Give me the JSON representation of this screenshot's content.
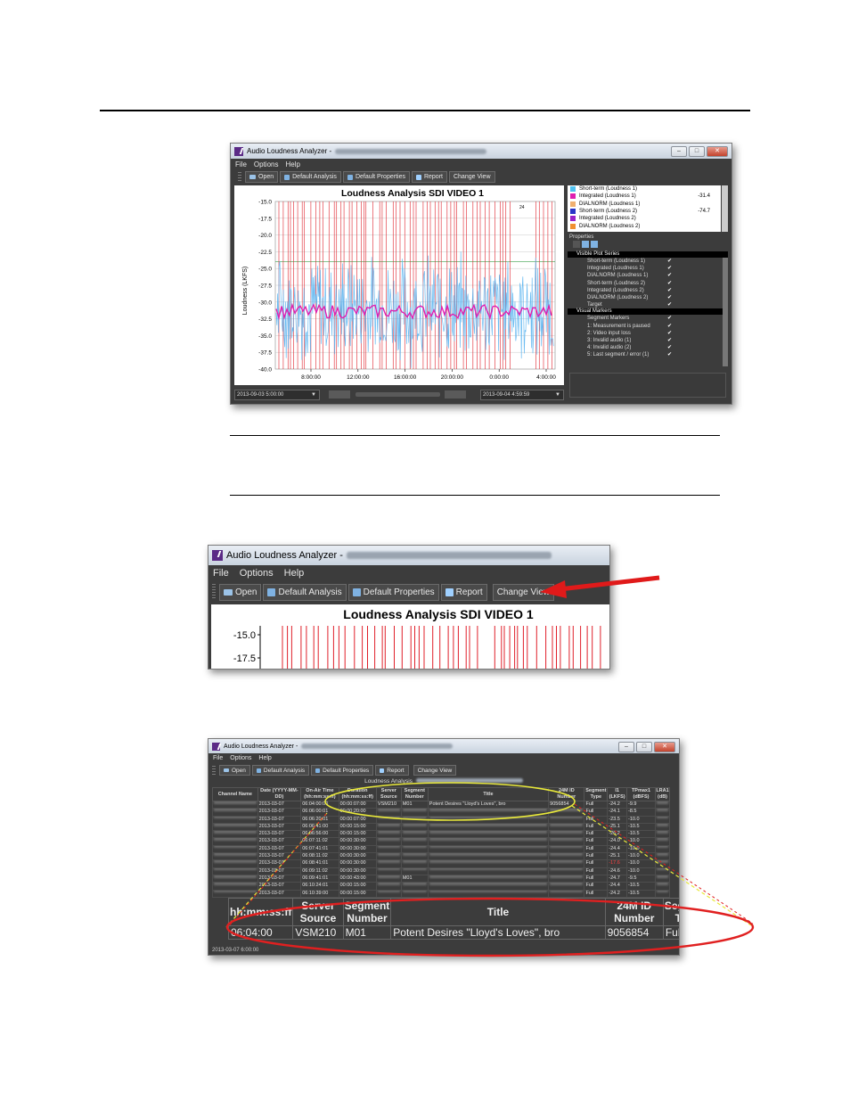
{
  "app": {
    "title": "Audio Loudness Analyzer -",
    "menus": [
      "File",
      "Options",
      "Help"
    ],
    "toolbar": {
      "open": "Open",
      "default_analysis": "Default Analysis",
      "default_properties": "Default Properties",
      "report": "Report",
      "change_view": "Change View"
    },
    "window_buttons": {
      "minimize": "–",
      "maximize": "□",
      "close": "✕"
    }
  },
  "graph_view": {
    "chart_data": {
      "type": "line",
      "title": "Loudness Analysis SDI VIDEO 1",
      "ylabel": "Loudness (LKFS)",
      "y_ticks": [
        "-15.0",
        "-17.5",
        "-20.0",
        "-22.5",
        "-25.0",
        "-27.5",
        "-30.0",
        "-32.5",
        "-35.0",
        "-37.5",
        "-40.0"
      ],
      "ylim": [
        -40.0,
        -15.0
      ],
      "x_ticks": [
        "8:00:00",
        "12:00:00",
        "16:00:00",
        "20:00:00",
        "0:00:00",
        "4:00:00"
      ],
      "series": [
        {
          "name": "Short-term (Loudness 1)",
          "color": "#5ab4f0"
        },
        {
          "name": "Integrated (Loudness 1)",
          "color": "#e01fb0"
        }
      ],
      "segment_markers_color": "#e0202a",
      "segment_marker_label": "24"
    },
    "legend": [
      {
        "name": "Short-term (Loudness 1)",
        "color": "#4fc1f0",
        "value": ""
      },
      {
        "name": "Integrated (Loudness 1)",
        "color": "#e01fb0",
        "value": "-31.4"
      },
      {
        "name": "DIALNORM (Loudness 1)",
        "color": "#f0b070",
        "value": ""
      },
      {
        "name": "Short-term (Loudness 2)",
        "color": "#2a35c8",
        "value": "-74.7"
      },
      {
        "name": "Integrated (Loudness 2)",
        "color": "#9a22c8",
        "value": ""
      },
      {
        "name": "DIALNORM (Loudness 2)",
        "color": "#f09030",
        "value": ""
      }
    ],
    "properties_title": "Properties",
    "visible_plot_series_header": "Visible Plot Series",
    "visible_plot_series": [
      "Short-term (Loudness 1)",
      "Integrated (Loudness 1)",
      "DIALNORM (Loudness 1)",
      "Short-term (Loudness 2)",
      "Integrated (Loudness 2)",
      "DIALNORM (Loudness 2)",
      "Target"
    ],
    "visual_markers_header": "Visual Markers",
    "visual_markers": [
      "Segment Markers",
      "1: Measurement is paused",
      "2: Video input loss",
      "3: Invalid audio (1)",
      "4: Invalid audio (2)",
      "5: Last segment / error (1)"
    ],
    "checkmark": "✔",
    "start_time": "2013-09-03 5:00:00",
    "end_time": "2013-09-04 4:59:59"
  },
  "crop_view": {
    "title": "Loudness Analysis SDI VIDEO 1",
    "y_ticks": [
      "-15.0",
      "-17.5"
    ]
  },
  "table_view": {
    "title": "Loudness Analysis",
    "columns": [
      "Channel Name",
      "Date (YYYY-MM-DD)",
      "On-Air Time (hh:mm:ss:ff)",
      "Duration (hh:mm:ss:ff)",
      "Server Source",
      "Segment Number",
      "Title",
      "24M ID Number",
      "Segment Type",
      "I1 (LKFS)",
      "TPmax1 (dBFS)",
      "LRA1 (dB)"
    ],
    "rows": [
      {
        "date": "2013-03-07",
        "time": "06:04:00:00",
        "dur": "00:00:07:00",
        "src": "VSM210",
        "seg": "M01",
        "title": "Potent Desires \"Lloyd's Loves\", bro",
        "id": "9056854",
        "type": "Full",
        "i1": "-24.2",
        "tp": "-9.9"
      },
      {
        "date": "2013-03-07",
        "time": "06:06:00:01",
        "dur": "00:00:20:00",
        "src": "",
        "seg": "",
        "title": "",
        "id": "",
        "type": "Full",
        "i1": "-24.1",
        "tp": "-8.5"
      },
      {
        "date": "2013-03-07",
        "time": "06:06:20:01",
        "dur": "00:00:07:00",
        "src": "",
        "seg": "",
        "title": "",
        "id": "",
        "type": "Full",
        "i1": "-23.5",
        "tp": "-10.0"
      },
      {
        "date": "2013-03-07",
        "time": "06:06:41:00",
        "dur": "00:00:15:00",
        "src": "",
        "seg": "",
        "title": "",
        "id": "",
        "type": "Full",
        "i1": "-25.1",
        "tp": "-10.5"
      },
      {
        "date": "2013-03-07",
        "time": "06:06:56:00",
        "dur": "00:00:15:00",
        "src": "",
        "seg": "",
        "title": "",
        "id": "",
        "type": "Full",
        "i1": "-26.2",
        "tp": "-10.5"
      },
      {
        "date": "2013-03-07",
        "time": "06:07:11:02",
        "dur": "00:00:30:00",
        "src": "",
        "seg": "",
        "title": "",
        "id": "",
        "type": "Full",
        "i1": "-24.0",
        "tp": "-10.0"
      },
      {
        "date": "2013-03-07",
        "time": "06:07:41:01",
        "dur": "00:00:30:00",
        "src": "",
        "seg": "",
        "title": "",
        "id": "",
        "type": "Full",
        "i1": "-24.4",
        "tp": "-10.0"
      },
      {
        "date": "2013-03-07",
        "time": "06:08:11:02",
        "dur": "00:00:30:00",
        "src": "",
        "seg": "",
        "title": "",
        "id": "",
        "type": "Full",
        "i1": "-25.1",
        "tp": "-10.0"
      },
      {
        "date": "2013-03-07",
        "time": "06:08:41:01",
        "dur": "00:00:30:00",
        "src": "",
        "seg": "",
        "title": "",
        "id": "",
        "type": "Full",
        "i1": "-17.6",
        "tp": "-10.0"
      },
      {
        "date": "2013-03-07",
        "time": "06:09:11:02",
        "dur": "00:00:30:00",
        "src": "",
        "seg": "",
        "title": "",
        "id": "",
        "type": "Full",
        "i1": "-24.6",
        "tp": "-10.0"
      },
      {
        "date": "2013-03-07",
        "time": "06:09:41:01",
        "dur": "00:00:43:00",
        "src": "",
        "seg": "M01",
        "title": "",
        "id": "",
        "type": "Full",
        "i1": "-24.7",
        "tp": "-9.5"
      },
      {
        "date": "2013-03-07",
        "time": "06:10:24:01",
        "dur": "00:00:15:00",
        "src": "",
        "seg": "",
        "title": "",
        "id": "",
        "type": "Full",
        "i1": "-24.4",
        "tp": "-10.5"
      },
      {
        "date": "2013-03-07",
        "time": "06:10:39:00",
        "dur": "00:00:15:00",
        "src": "",
        "seg": "",
        "title": "",
        "id": "",
        "type": "Full",
        "i1": "-24.2",
        "tp": "-10.5"
      }
    ],
    "status": "2013-03-07 6:00:00",
    "zoom": {
      "headers": [
        {
          "line1": "",
          "line2": "hh:mm:ss:ff"
        },
        {
          "line1": "Server",
          "line2": "Source"
        },
        {
          "line1": "Segment",
          "line2": "Number"
        },
        {
          "line1": "Title",
          "line2": ""
        },
        {
          "line1": "24M ID",
          "line2": "Number"
        },
        {
          "line1": "Segment",
          "line2": "Type"
        },
        {
          "line1": "",
          "line2": "(LKFS)"
        }
      ],
      "row": [
        "06:04:00",
        "VSM210",
        "M01",
        "Potent Desires \"Lloyd's Loves\", bro",
        "9056854",
        "Full",
        "-24.2"
      ]
    }
  }
}
